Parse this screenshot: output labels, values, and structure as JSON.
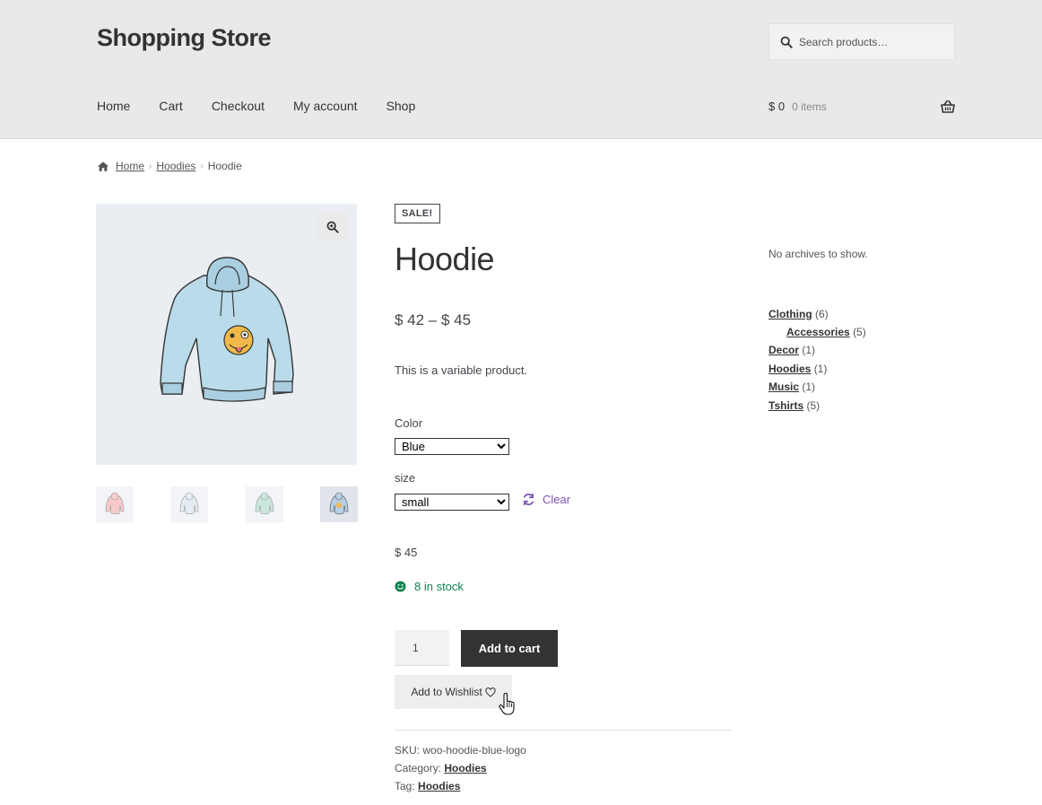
{
  "header": {
    "site_title": "Shopping Store",
    "search_placeholder": "Search products…",
    "nav": [
      "Home",
      "Cart",
      "Checkout",
      "My account",
      "Shop"
    ],
    "cart_amount": "$ 0",
    "cart_items": "0 items"
  },
  "breadcrumb": {
    "home": "Home",
    "category": "Hoodies",
    "current": "Hoodie",
    "separator": "›"
  },
  "product": {
    "sale_badge": "SALE!",
    "title": "Hoodie",
    "price_range": "$ 42 – $ 45",
    "short_description": "This is a variable product.",
    "color_label": "Color",
    "color_selected": "Blue",
    "size_label": "size",
    "size_selected": "small",
    "clear_label": "Clear",
    "variation_price": "$ 45",
    "stock": "8 in stock",
    "quantity": "1",
    "add_to_cart_label": "Add to cart",
    "wishlist_label": "Add to Wishlist",
    "sku_label": "SKU:",
    "sku_value": "woo-hoodie-blue-logo",
    "category_label": "Category:",
    "category_value": "Hoodies",
    "tag_label": "Tag:",
    "tag_value": "Hoodies"
  },
  "gallery": {
    "thumbnail_colors": [
      "#f1a7a7",
      "#cfe0ea",
      "#a9d8c4",
      "#b7cfe4"
    ]
  },
  "sidebar": {
    "no_archives": "No archives to show.",
    "categories": [
      {
        "name": "Clothing",
        "count": "(6)"
      },
      {
        "name": "Accessories",
        "count": "(5)"
      },
      {
        "name": "Decor",
        "count": "(1)"
      },
      {
        "name": "Hoodies",
        "count": "(1)"
      },
      {
        "name": "Music",
        "count": "(1)"
      },
      {
        "name": "Tshirts",
        "count": "(5)"
      }
    ]
  },
  "colors": {
    "header_bg": "#e9e9e9",
    "dark_button": "#333333",
    "accent_purple": "#7f54b3",
    "stock_green": "#0f834d",
    "hoodie_blue": "#b9dbea"
  }
}
